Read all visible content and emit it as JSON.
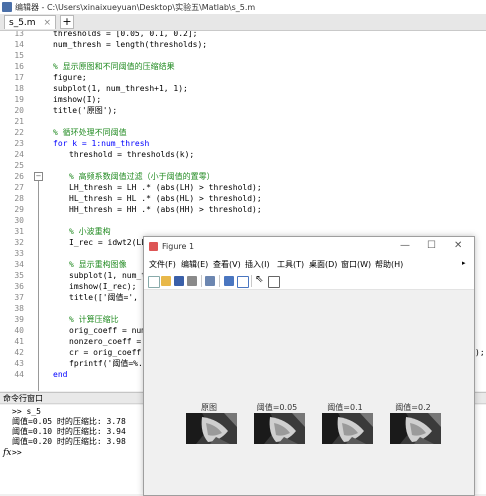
{
  "window_title": "编辑器 - C:\\Users\\xinaixueyuan\\Desktop\\实验五\\Matlab\\s_5.m",
  "tab": {
    "label": "s_5.m",
    "close": "×",
    "plus": "+"
  },
  "editor": {
    "lines": [
      {
        "n": "13",
        "text": "thresholds = [0.05, 0.1, 0.2];",
        "indent": 0,
        "type": "code"
      },
      {
        "n": "14",
        "text": "num_thresh = length(thresholds);",
        "indent": 0,
        "type": "code"
      },
      {
        "n": "15",
        "text": "",
        "indent": 0,
        "type": "code"
      },
      {
        "n": "16",
        "text": "% 显示原图和不同阈值的压缩结果",
        "indent": 0,
        "type": "comment"
      },
      {
        "n": "17",
        "text": "figure;",
        "indent": 0,
        "type": "code"
      },
      {
        "n": "18",
        "text": "subplot(1, num_thresh+1, 1);",
        "indent": 0,
        "type": "code"
      },
      {
        "n": "19",
        "text": "imshow(I);",
        "indent": 0,
        "type": "code"
      },
      {
        "n": "20",
        "text": "title('原图');",
        "indent": 0,
        "type": "code"
      },
      {
        "n": "21",
        "text": "",
        "indent": 0,
        "type": "code"
      },
      {
        "n": "22",
        "text": "% 循环处理不同阈值",
        "indent": 0,
        "type": "comment"
      },
      {
        "n": "23",
        "text": "for k = 1:num_thresh",
        "indent": 0,
        "type": "kw"
      },
      {
        "n": "24",
        "text": "threshold = thresholds(k);",
        "indent": 1,
        "type": "code"
      },
      {
        "n": "25",
        "text": "",
        "indent": 0,
        "type": "code"
      },
      {
        "n": "26",
        "text": "% 高频系数阈值过滤（小于阈值的置零）",
        "indent": 1,
        "type": "comment"
      },
      {
        "n": "27",
        "text": "LH_thresh = LH .* (abs(LH) > threshold);",
        "indent": 1,
        "type": "code"
      },
      {
        "n": "28",
        "text": "HL_thresh = HL .* (abs(HL) > threshold);",
        "indent": 1,
        "type": "code"
      },
      {
        "n": "29",
        "text": "HH_thresh = HH .* (abs(HH) > threshold);",
        "indent": 1,
        "type": "code"
      },
      {
        "n": "30",
        "text": "",
        "indent": 0,
        "type": "code"
      },
      {
        "n": "31",
        "text": "% 小波重构",
        "indent": 1,
        "type": "comment"
      },
      {
        "n": "32",
        "text": "I_rec = idwt2(LL,",
        "indent": 1,
        "type": "code"
      },
      {
        "n": "33",
        "text": "",
        "indent": 0,
        "type": "code"
      },
      {
        "n": "34",
        "text": "% 显示重构图像",
        "indent": 1,
        "type": "comment"
      },
      {
        "n": "35",
        "text": "subplot(1, num_th",
        "indent": 1,
        "type": "code"
      },
      {
        "n": "36",
        "text": "imshow(I_rec);",
        "indent": 1,
        "type": "code"
      },
      {
        "n": "37",
        "text": "title(['阈值=', n",
        "indent": 1,
        "type": "code"
      },
      {
        "n": "38",
        "text": "",
        "indent": 0,
        "type": "code"
      },
      {
        "n": "39",
        "text": "% 计算压缩比",
        "indent": 1,
        "type": "comment"
      },
      {
        "n": "40",
        "text": "orig_coeff = nume",
        "indent": 1,
        "type": "code"
      },
      {
        "n": "41",
        "text": "nonzero_coeff = n",
        "indent": 1,
        "type": "code"
      },
      {
        "n": "42",
        "text": "cr = orig_coeff /",
        "indent": 1,
        "type": "code"
      },
      {
        "n": "43",
        "text": "fprintf('阈值=%.2",
        "indent": 1,
        "type": "code"
      },
      {
        "n": "44",
        "text": "end",
        "indent": 0,
        "type": "kw"
      }
    ],
    "overflow_right": ");"
  },
  "command_window": {
    "title": "命令行窗口",
    "lines": [
      ">> s_5",
      "阈值=0.05 时的压缩比: 3.78",
      "阈值=0.10 时的压缩比: 3.94",
      "阈值=0.20 时的压缩比: 3.98"
    ],
    "fx": "fx",
    "prompt": ">>"
  },
  "figure": {
    "title": "Figure 1",
    "window_buttons": [
      "—",
      "☐",
      "✕"
    ],
    "menu": [
      "文件(F)",
      "编辑(E)",
      "查看(V)",
      "插入(I)",
      "工具(T)",
      "桌面(D)",
      "窗口(W)",
      "帮助(H)"
    ],
    "menu_arrow": "▸",
    "subplots": [
      "原图",
      "阈值=0.05",
      "阈值=0.1",
      "阈值=0.2"
    ]
  }
}
